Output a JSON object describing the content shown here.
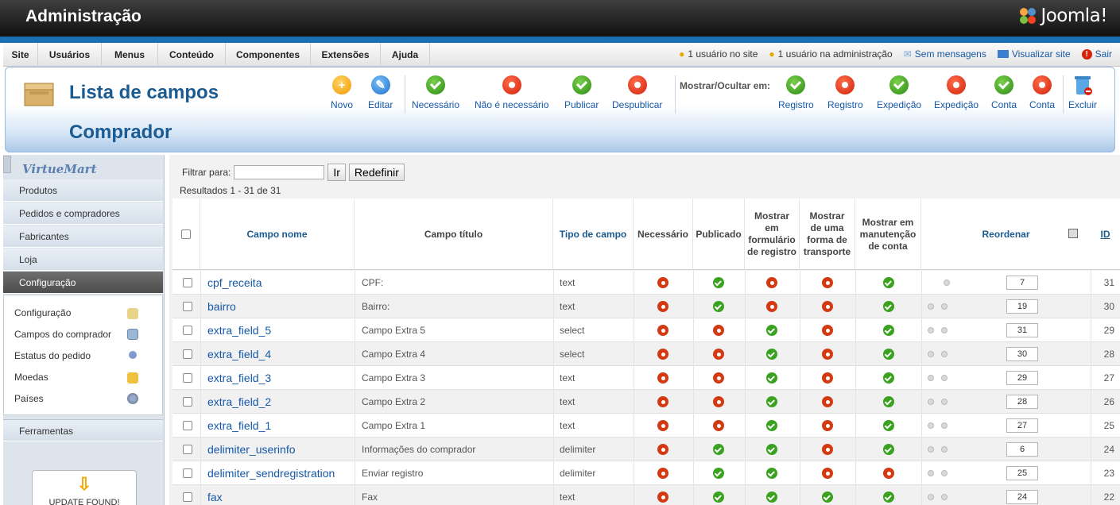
{
  "header": {
    "title": "Administração",
    "brand": "Joomla!"
  },
  "menu": [
    "Site",
    "Usuários",
    "Menus",
    "Conteúdo",
    "Componentes",
    "Extensões",
    "Ajuda"
  ],
  "status": {
    "users_site": "1 usuário no site",
    "users_admin": "1 usuário na administração",
    "messages": "Sem mensagens",
    "view_site": "Visualizar site",
    "logout": "Sair"
  },
  "page": {
    "title": "Lista de campos",
    "subtitle": "Comprador"
  },
  "toolbar": {
    "new": "Novo",
    "edit": "Editar",
    "required": "Necessário",
    "not_required": "Não é necessário",
    "publish": "Publicar",
    "unpublish": "Despublicar",
    "show_hide_label": "Mostrar/Ocultar em:",
    "reg_show": "Registro",
    "reg_hide": "Registro",
    "ship_show": "Expedição",
    "ship_hide": "Expedição",
    "acc_show": "Conta",
    "acc_hide": "Conta",
    "delete": "Excluir"
  },
  "sidebar": {
    "logo": "VirtueMart",
    "items": [
      "Produtos",
      "Pedidos e compradores",
      "Fabricantes",
      "Loja",
      "Configuração"
    ],
    "subitems": [
      "Configuração",
      "Campos do comprador",
      "Estatus do pedido",
      "Moedas",
      "Países"
    ],
    "tools": "Ferramentas",
    "update": "UPDATE FOUND!"
  },
  "filter": {
    "label": "Filtrar para:",
    "value": "",
    "go": "Ir",
    "reset": "Redefinir",
    "results": "Resultados 1 - 31 de 31"
  },
  "table": {
    "headers": {
      "name": "Campo nome",
      "title": "Campo título",
      "type": "Tipo de campo",
      "required": "Necessário",
      "published": "Publicado",
      "show_reg": "Mostrar em formulário de registro",
      "show_ship": "Mostrar de uma forma de transporte",
      "show_acc": "Mostrar em manutenção de conta",
      "reorder": "Reordenar",
      "id": "ID"
    },
    "rows": [
      {
        "name": "cpf_receita",
        "title": "CPF:",
        "type": "text",
        "required": false,
        "published": true,
        "reg": false,
        "ship": false,
        "acc": true,
        "order": "7",
        "id": "31",
        "arrows": 1
      },
      {
        "name": "bairro",
        "title": "Bairro:",
        "type": "text",
        "required": false,
        "published": true,
        "reg": false,
        "ship": false,
        "acc": true,
        "order": "19",
        "id": "30",
        "arrows": 2
      },
      {
        "name": "extra_field_5",
        "title": "Campo Extra 5",
        "type": "select",
        "required": false,
        "published": false,
        "reg": true,
        "ship": false,
        "acc": true,
        "order": "31",
        "id": "29",
        "arrows": 2
      },
      {
        "name": "extra_field_4",
        "title": "Campo Extra 4",
        "type": "select",
        "required": false,
        "published": false,
        "reg": true,
        "ship": false,
        "acc": true,
        "order": "30",
        "id": "28",
        "arrows": 2
      },
      {
        "name": "extra_field_3",
        "title": "Campo Extra 3",
        "type": "text",
        "required": false,
        "published": false,
        "reg": true,
        "ship": false,
        "acc": true,
        "order": "29",
        "id": "27",
        "arrows": 2
      },
      {
        "name": "extra_field_2",
        "title": "Campo Extra 2",
        "type": "text",
        "required": false,
        "published": false,
        "reg": true,
        "ship": false,
        "acc": true,
        "order": "28",
        "id": "26",
        "arrows": 2
      },
      {
        "name": "extra_field_1",
        "title": "Campo Extra 1",
        "type": "text",
        "required": false,
        "published": false,
        "reg": true,
        "ship": false,
        "acc": true,
        "order": "27",
        "id": "25",
        "arrows": 2
      },
      {
        "name": "delimiter_userinfo",
        "title": "Informações do comprador",
        "type": "delimiter",
        "required": false,
        "published": true,
        "reg": true,
        "ship": false,
        "acc": true,
        "order": "6",
        "id": "24",
        "arrows": 2
      },
      {
        "name": "delimiter_sendregistration",
        "title": "Enviar registro",
        "type": "delimiter",
        "required": false,
        "published": true,
        "reg": true,
        "ship": false,
        "acc": false,
        "order": "25",
        "id": "23",
        "arrows": 2
      },
      {
        "name": "fax",
        "title": "Fax",
        "type": "text",
        "required": false,
        "published": true,
        "reg": true,
        "ship": true,
        "acc": true,
        "order": "24",
        "id": "22",
        "arrows": 2
      }
    ]
  },
  "colors": {
    "accent": "#1a5b92",
    "yes": "#3aa21f",
    "no": "#d43a12"
  }
}
